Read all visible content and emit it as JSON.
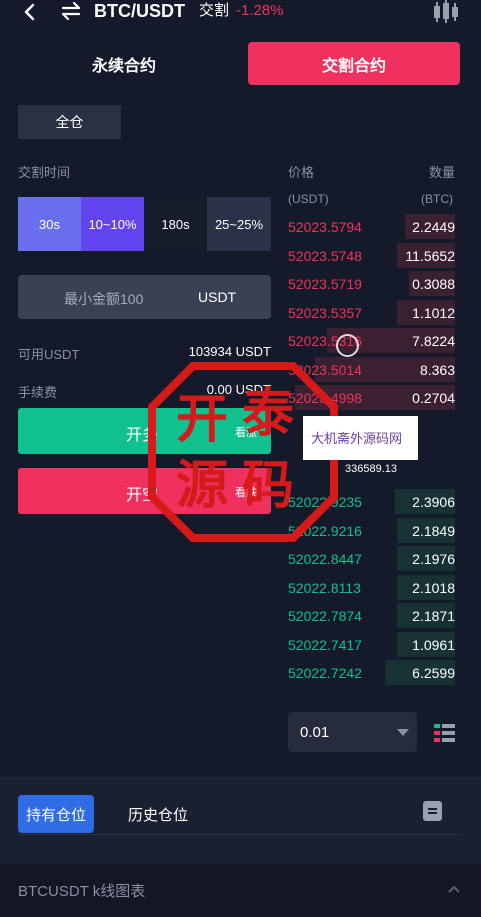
{
  "header": {
    "pair": "BTC/USDT",
    "type": "交割",
    "change": "-1.28%"
  },
  "tabs": {
    "perpetual": "永续合约",
    "delivery": "交割合约"
  },
  "order_form": {
    "margin_mode": "全仓",
    "time_label": "交割时间",
    "time_options": [
      "30s",
      "10~10%",
      "180s",
      "25~25%"
    ],
    "amount_placeholder": "最小金额100",
    "amount_unit": "USDT",
    "available_label": "可用USDT",
    "available_value": "103934 USDT",
    "fee_label": "手续费",
    "fee_value": "0.00 USDT",
    "long_label": "开多",
    "long_sub": "看涨",
    "short_label": "开空",
    "short_sub": "看跌"
  },
  "order_book": {
    "price_header": "价格",
    "qty_header": "数量",
    "price_unit": "(USDT)",
    "qty_unit": "(BTC)",
    "asks": [
      {
        "price": "52023.5794",
        "qty": "2.2449"
      },
      {
        "price": "52023.5748",
        "qty": "11.5652"
      },
      {
        "price": "52023.5719",
        "qty": "0.3088"
      },
      {
        "price": "52023.5357",
        "qty": "1.1012"
      },
      {
        "price": "52023.5316",
        "qty": "7.8224"
      },
      {
        "price": "52023.5014",
        "qty": "8.363"
      },
      {
        "price": "52023.4998",
        "qty": "0.2704"
      }
    ],
    "mid_price": "336589.13",
    "bids": [
      {
        "price": "52022.9235",
        "qty": "2.3906"
      },
      {
        "price": "52022.9216",
        "qty": "2.1849"
      },
      {
        "price": "52022.8447",
        "qty": "2.1976"
      },
      {
        "price": "52022.8113",
        "qty": "2.1018"
      },
      {
        "price": "52022.7874",
        "qty": "2.1871"
      },
      {
        "price": "52022.7417",
        "qty": "1.0961"
      },
      {
        "price": "52022.7242",
        "qty": "6.2599"
      }
    ],
    "precision": "0.01"
  },
  "positions": {
    "holding_tab": "持有仓位",
    "history_tab": "历史仓位"
  },
  "footer": {
    "label": "BTCUSDT  k线图表"
  },
  "watermark": {
    "seal_chars": [
      "开",
      "泰",
      "源",
      "码"
    ],
    "banner": "大机斋外源码网"
  },
  "colors": {
    "background": "#151a2a",
    "up": "#10c08e",
    "down": "#f0325a",
    "accent": "#6244ee",
    "tab_active": "#2f6de6"
  }
}
